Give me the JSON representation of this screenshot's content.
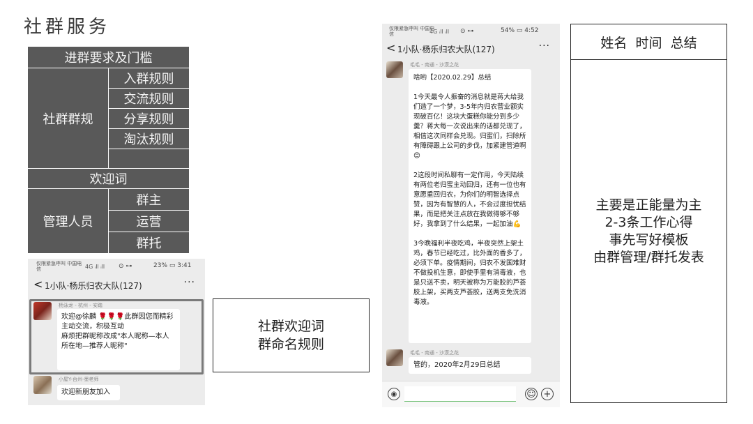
{
  "page_title": "社群服务",
  "rules_table": {
    "header": "进群要求及门槛",
    "group_rules_label": "社群群规",
    "group_rules": [
      "入群规则",
      "交流规则",
      "分享规则",
      "淘汰规则",
      ""
    ],
    "welcome": "欢迎词",
    "staff_label": "管理人员",
    "staff": [
      "群主",
      "运营",
      "群托"
    ]
  },
  "phone_welcome": {
    "carrier": "仅限紧急呼叫 中国电信",
    "signal": "4G ᵢll ᵢll",
    "status_icons": "⊙ ⊶",
    "battery": "23% ▭ 3:41",
    "back": "<",
    "chat_title": "1小队·杨乐归农大队(127)",
    "more": "···",
    "messages": [
      {
        "sender": "杨泳龙 - 杭州 - 安踏",
        "text": "欢迎@徐麟 🌹🌹🌹此群因您而精彩\n主动交流，积极互动\n麻烦把群昵称改成\"本人昵称—本人所在地—推荐人昵称\""
      },
      {
        "sender": "小屋Y-台州-墨老师",
        "text": "欢迎新朋友加入"
      }
    ]
  },
  "welcome_box": {
    "lines": [
      "社群欢迎词",
      "群命名规则"
    ]
  },
  "phone_summary": {
    "carrier": "仅限紧急呼叫 中国电信",
    "signal": "4G ᵢll ᵢll",
    "status_icons": "⊙ ⊶",
    "battery": "54% ▭ 4:52",
    "back": "<",
    "chat_title": "1小队·杨乐归农大队(127)",
    "more": "···",
    "msg1_sender": "毛毛 - 南通 - 沙漠之花",
    "msg1_title": "啥哟【2020.02.29】总结",
    "msg1_p1": "1今天最令人振奋的消息就是蒋大给我们造了一个梦，3-5年内归农营业额实现破百亿！这块大蛋糕你能分到多少羹？蒋大每一次说出来的话都兑现了，相信这次同样会兑现。归蜜们，扫除所有障碍跟上公司的步伐，加紧建管道啊😊",
    "msg1_p2": "2这段时间私聊有一定作用，今天陆续有两位老归蜜主动回归，还有一位也有意愿重回归农，为你们的明智选择点赞，因为有智慧的人，不会过度担忧结果，而是把关注点放在我做得够不够好，我拿到了什么结果，一起加油💪",
    "msg1_p3": "3今晚福利半夜吃鸡，半夜突然上架土鸡，春节已经吃过，比外面的香多了，必须下单。疫情期间，归农不发国难财不做投机生意，即使手里有消毒液，也是只送不卖，明天被称为万能胶的芦荟胶上架，买两支芦荟胶，送两支免洗消毒液。",
    "msg2_sender": "毛毛 - 南通 - 沙漠之花",
    "msg2_text": "管的，2020年2月29日总结",
    "voice_icon": "◉",
    "emoji_icon": "☺",
    "plus_icon": "+"
  },
  "summary_table": {
    "header": "姓名  时间  总结",
    "body_lines": [
      "主要是正能量为主",
      "2-3条工作心得",
      "事先写好模板",
      "由群管理/群托发表"
    ]
  }
}
